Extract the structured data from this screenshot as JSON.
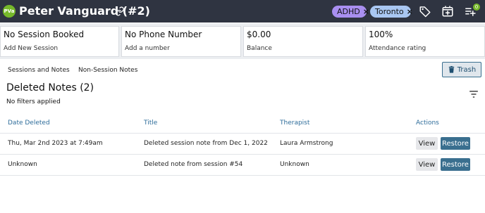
{
  "header": {
    "avatar_initials": "PVa",
    "client_name": "Peter Vanguard (#2)",
    "tags": [
      {
        "label": "ADHD",
        "color": "#a98ff0"
      },
      {
        "label": "Toronto",
        "color": "#a9c7f2"
      }
    ],
    "tag_remove_glyph": "×",
    "notification_count": "0",
    "icons": [
      "link-icon",
      "tag-icon",
      "calendar-add-icon",
      "playlist-add-icon"
    ]
  },
  "summary": [
    {
      "value": "No Session Booked",
      "caption": "Add New Session"
    },
    {
      "value": "No Phone Number",
      "caption": "Add a number"
    },
    {
      "value": "$0.00",
      "caption": "Balance"
    },
    {
      "value": "100%",
      "caption": "Attendance rating"
    }
  ],
  "tabs": [
    {
      "label": "Sessions and Notes"
    },
    {
      "label": "Non-Session Notes"
    }
  ],
  "trash_button": {
    "label": "Trash"
  },
  "section": {
    "title": "Deleted Notes (2)",
    "filters_text": "No filters applied"
  },
  "table": {
    "columns": [
      "Date Deleted",
      "Title",
      "Therapist",
      "Actions"
    ],
    "rows": [
      {
        "date": "Thu, Mar 2nd 2023 at 7:49am",
        "title": "Deleted session note from Dec 1, 2022",
        "therapist": "Laura Armstrong",
        "view": "View",
        "restore": "Restore"
      },
      {
        "date": "Unknown",
        "title": "Deleted note from session #54",
        "therapist": "Unknown",
        "view": "View",
        "restore": "Restore"
      }
    ]
  },
  "colors": {
    "header_bg": "#2f3441",
    "accent_green": "#76b82a",
    "primary_button": "#3a6f8f",
    "column_header": "#2d6c9a"
  }
}
